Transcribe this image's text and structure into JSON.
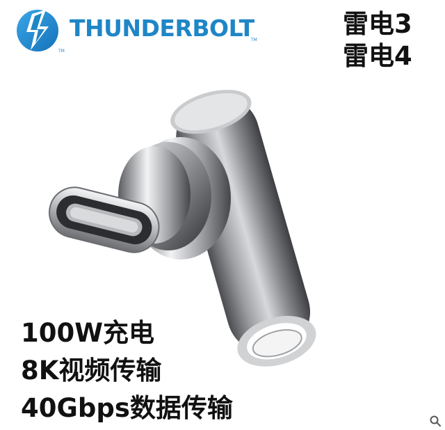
{
  "brand": {
    "name": "THUNDERBOLT",
    "trademark": "TM",
    "color": "#1f86c6",
    "icon": "thunderbolt-bolt-icon"
  },
  "versions": [
    "雷电3",
    "雷电4"
  ],
  "features": [
    "100W充电",
    "8K视频传输",
    "40Gbps数据传输"
  ],
  "product": {
    "description_icon": "usb-c-right-angle-adapter"
  },
  "corner": {
    "icon": "search-icon"
  }
}
